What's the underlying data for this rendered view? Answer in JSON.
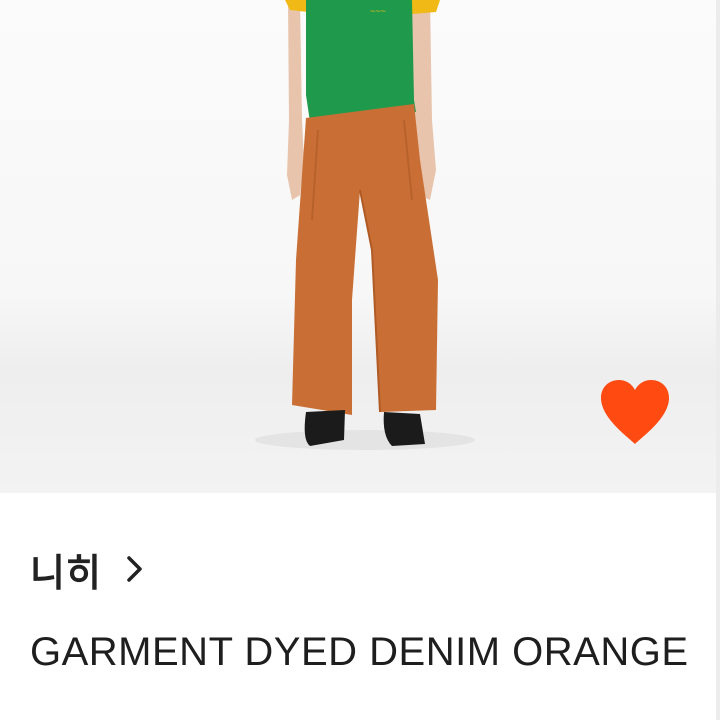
{
  "product": {
    "shop_name": "니히",
    "title": "GARMENT DYED DENIM ORANGE"
  },
  "icons": {
    "favorite": "heart-icon",
    "shop_link": "chevron-right-icon"
  },
  "colors": {
    "heart": "#ff4b12",
    "pants": "#c96f35",
    "shirt": "#1f9a4c",
    "shirt_trim": "#f1b915"
  }
}
